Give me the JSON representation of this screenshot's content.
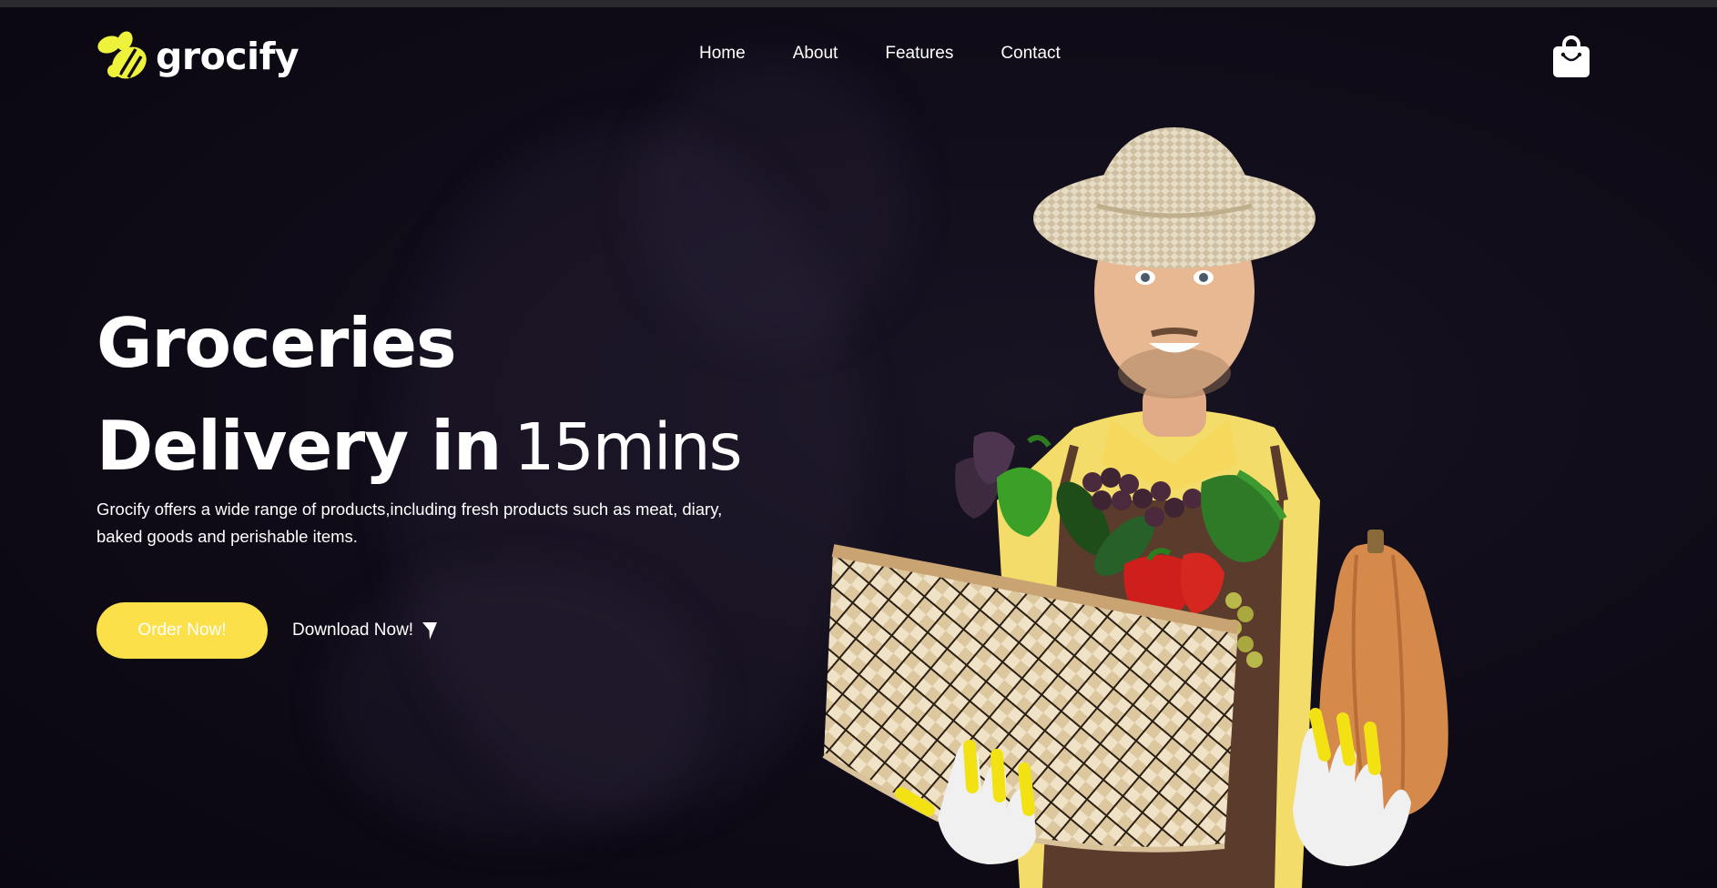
{
  "brand": {
    "name": "grocify"
  },
  "nav": {
    "links": [
      {
        "label": "Home"
      },
      {
        "label": "About"
      },
      {
        "label": "Features"
      },
      {
        "label": "Contact"
      }
    ]
  },
  "cart": {
    "icon": "shopping-bag-icon"
  },
  "hero": {
    "title_line1": "Groceries",
    "title_line2_strong": "Delivery in",
    "title_line2_light": "15mins",
    "description": "Grocify offers a wide range of products,including fresh products such as meat, diary, baked goods and perishable items.",
    "order_button": "Order Now!",
    "download_label": "Download Now!",
    "download_icon": "cursor-arrow-icon"
  },
  "colors": {
    "accent": "#fbe04a",
    "background": "#0f0b17",
    "text": "#ffffff"
  }
}
